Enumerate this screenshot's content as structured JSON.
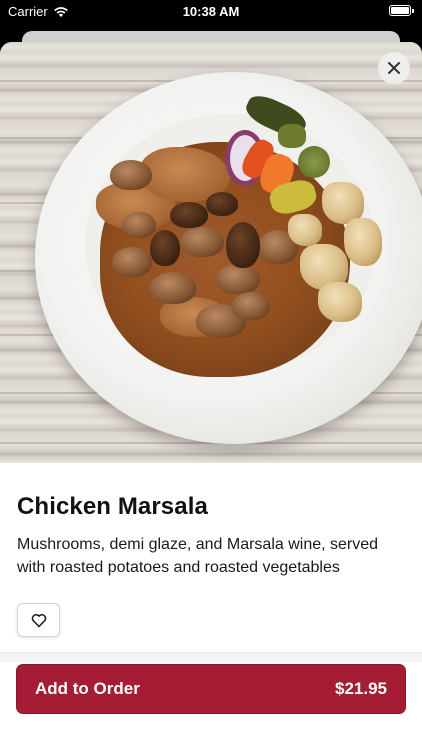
{
  "status_bar": {
    "carrier": "Carrier",
    "time": "10:38 AM"
  },
  "item": {
    "title": "Chicken Marsala",
    "description": "Mushrooms, demi glaze, and Marsala wine, served with roasted potatoes and roasted vegetables",
    "image_icon": "food-photo"
  },
  "actions": {
    "close_icon": "close-icon",
    "favorite_icon": "heart-icon",
    "add_label": "Add to Order",
    "price": "$21.95"
  },
  "colors": {
    "accent": "#a41d34",
    "text": "#111111"
  }
}
